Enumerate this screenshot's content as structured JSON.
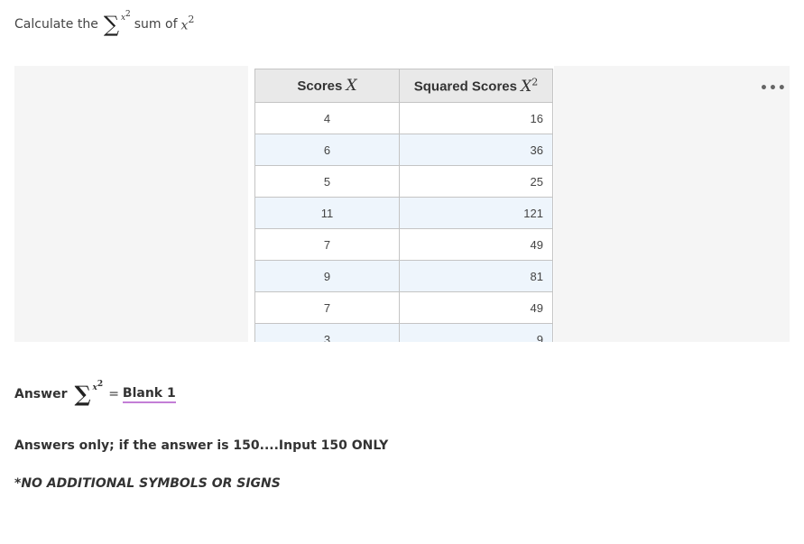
{
  "question": {
    "prefix": "Calculate the",
    "sigma": "∑",
    "sigma_sup_var": "x",
    "sigma_sup_exp": "2",
    "suffix": "sum of",
    "var": "x",
    "exp": "2"
  },
  "table": {
    "headers": [
      {
        "text": "Scores",
        "math": "X",
        "exp": ""
      },
      {
        "text": "Squared Scores",
        "math": "X",
        "exp": "2"
      }
    ],
    "rows": [
      {
        "x": "4",
        "x2": "16"
      },
      {
        "x": "6",
        "x2": "36"
      },
      {
        "x": "5",
        "x2": "25"
      },
      {
        "x": "11",
        "x2": "121"
      },
      {
        "x": "7",
        "x2": "49"
      },
      {
        "x": "9",
        "x2": "81"
      },
      {
        "x": "7",
        "x2": "49"
      },
      {
        "x": "3",
        "x2": "9"
      }
    ],
    "more_menu": "•••"
  },
  "answer": {
    "label": "Answer",
    "sigma": "∑",
    "sup_var": "x",
    "sup_exp": "2",
    "equals": "=",
    "blank": "Blank 1"
  },
  "notes": {
    "instruction": "Answers only; if the answer is 150....Input 150 ONLY",
    "warning": "*NO ADDITIONAL SYMBOLS OR SIGNS"
  },
  "colors": {
    "blank_underline": "#c37ed6",
    "row_alt": "#eef5fc",
    "header_bg": "#e9e9e9"
  }
}
